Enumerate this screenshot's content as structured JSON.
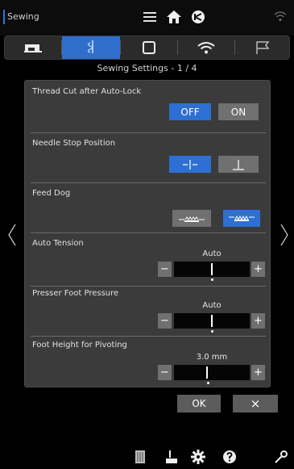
{
  "status_bar": {
    "app_title": "Sewing",
    "icons": [
      "menu-icon",
      "home-icon",
      "sewing-mode-icon",
      "wifi-icon"
    ]
  },
  "tabs": [
    {
      "name": "machine",
      "icon": "machine-icon"
    },
    {
      "name": "stitch-settings",
      "icon": "needle-thread-icon",
      "active": true
    },
    {
      "name": "square",
      "icon": "square-icon"
    },
    {
      "name": "wifi",
      "icon": "wifi-icon"
    },
    {
      "name": "flag",
      "icon": "flag-icon"
    }
  ],
  "page_title": "Sewing Settings - 1 / 4",
  "settings": {
    "thread_cut": {
      "label": "Thread Cut after Auto-Lock",
      "off": "OFF",
      "on": "ON",
      "selected": "OFF"
    },
    "needle_stop": {
      "label": "Needle Stop Position",
      "selected": "up"
    },
    "feed_dog": {
      "label": "Feed Dog",
      "selected": "up"
    },
    "auto_tension": {
      "label": "Auto Tension",
      "value": "Auto",
      "minus": "−",
      "plus": "+"
    },
    "presser_foot": {
      "label": "Presser Foot Pressure",
      "value": "Auto",
      "minus": "−",
      "plus": "+"
    },
    "foot_height": {
      "label": "Foot Height for Pivoting",
      "value": "3.0 mm",
      "minus": "−",
      "plus": "+"
    }
  },
  "actions": {
    "ok": "OK",
    "cancel": "×"
  },
  "nav": {
    "prev": "‹",
    "next": "›"
  },
  "footer_icons": [
    "stitch-grid-icon",
    "thread-cutter-icon",
    "settings-icon",
    "help-icon",
    "wrench-icon"
  ],
  "colors": {
    "accent": "#2e6fd4",
    "panel": "#3b3b3b",
    "button": "#707070"
  }
}
